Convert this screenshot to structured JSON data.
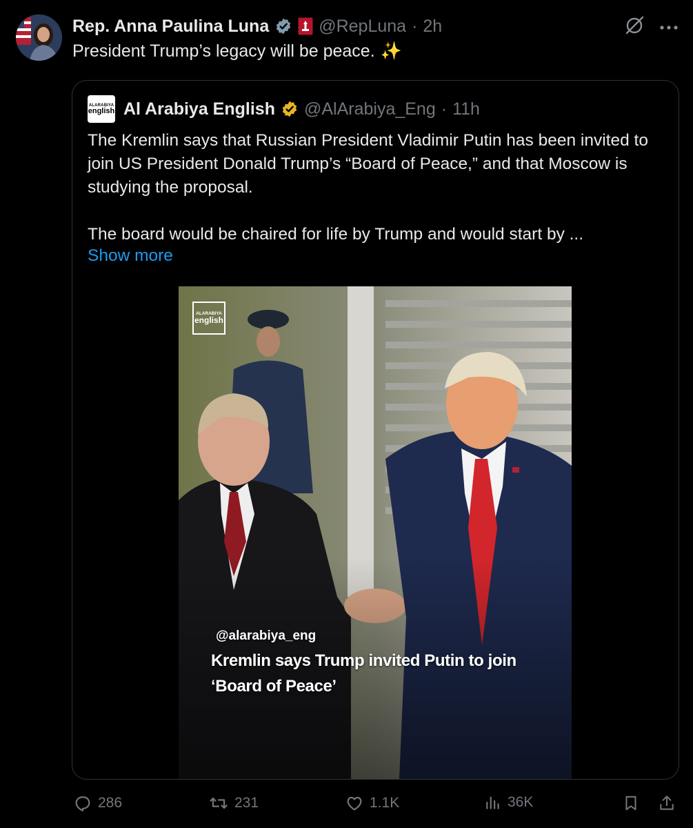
{
  "post": {
    "author": {
      "display_name": "Rep. Anna Paulina Luna",
      "handle": "@RepLuna",
      "separator": "·",
      "time": "2h"
    },
    "text": "President Trump’s legacy will be peace.",
    "emoji": "✨",
    "icons": {
      "verified": "verified-badge-icon",
      "affiliation": "government-affiliation-icon",
      "grok": "grok-icon",
      "more": "more-icon"
    },
    "colors": {
      "verified": "#1d9bf0",
      "link": "#1d9bf0",
      "gold_badge": "#e6b422"
    }
  },
  "quote": {
    "logo_line1": "ALARABIYA",
    "logo_line2": "english",
    "display_name": "Al Arabiya English",
    "handle": "@AlArabiya_Eng",
    "separator": "·",
    "time": "11h",
    "paragraph1": "The Kremlin says that Russian President Vladimir Putin has been invited to join US President Donald Trump’s “Board of Peace,” and  that Moscow is studying the proposal.",
    "paragraph2": "The board would be chaired for life by Trump and would start by ...",
    "show_more": "Show more",
    "media": {
      "logo_line1": "ALARABIYA",
      "logo_line2": "english",
      "handle": "@alarabiya_eng",
      "caption": "Kremlin says Trump invited Putin to join ‘Board of Peace’"
    }
  },
  "actions": {
    "replies": "286",
    "reposts": "231",
    "likes": "1.1K",
    "views": "36K",
    "icons": [
      "reply-icon",
      "repost-icon",
      "like-icon",
      "views-icon",
      "bookmark-icon",
      "share-icon"
    ]
  }
}
